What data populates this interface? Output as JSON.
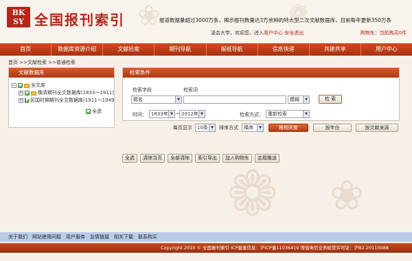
{
  "header": {
    "logo_mark": "BK\nSY",
    "logo_text": "全国报刊索引",
    "slogan": "报道数据量超过3000万条，揭示报刊数量达3万余种的特大型二次文献数据库，目前每年更新350万条",
    "welcome": "凌会大学，欢迎您，进入",
    "user_center": "用户中心",
    "logout": "安全退出",
    "cart": "购物车：当前购买0件"
  },
  "nav": [
    "首页",
    "数据库资源介绍",
    "文献检索",
    "期刊导航",
    "报纸导航",
    "信息快递",
    "共建共享",
    "用户中心"
  ],
  "breadcrumb": "首页 >>文献检索 >>普通检索",
  "left_panel": {
    "title": "文献数据库",
    "root": "全文库",
    "items": [
      "晚清期刊全文数据库(1833～1911)",
      "民国时期期刊全文数据库(1911～1949)"
    ],
    "select_all": "全选"
  },
  "search": {
    "title": "检索条件",
    "field_label": "检索字段",
    "term_label": "检索词",
    "field_value": "题名",
    "match_value": "模糊",
    "search_button": "检 索",
    "time_label": "时间：",
    "year_from": "1833年",
    "tilde": "~",
    "year_to": "2012年",
    "mode_label": "检索方式：",
    "mode_value": "重新检索"
  },
  "sort": {
    "per_page_label": "每页显示",
    "per_page_value": "10条",
    "order_label": "排序方式",
    "order_value": "降序",
    "by_relevance": "按相关度",
    "by_year": "按年份",
    "by_source": "按文献来源"
  },
  "actions": [
    "全选",
    "清除当页",
    "全部清除",
    "索引导出",
    "加入购物车",
    "定题推送"
  ],
  "footer": {
    "links": [
      "关于我们",
      "网站使用问题",
      "用户服务",
      "友情链接",
      "相关下载",
      "联系购买"
    ],
    "copyright": "Copyright 2010 © 全国报刊索引 ICP备案信息：沪ICP备11036419 增值电信业务经营许可证：沪B2-20110088"
  },
  "colors": {
    "brand_red": "#b2261c",
    "nav_orange": "#c0401a",
    "footer_blue": "#b9cde8"
  }
}
